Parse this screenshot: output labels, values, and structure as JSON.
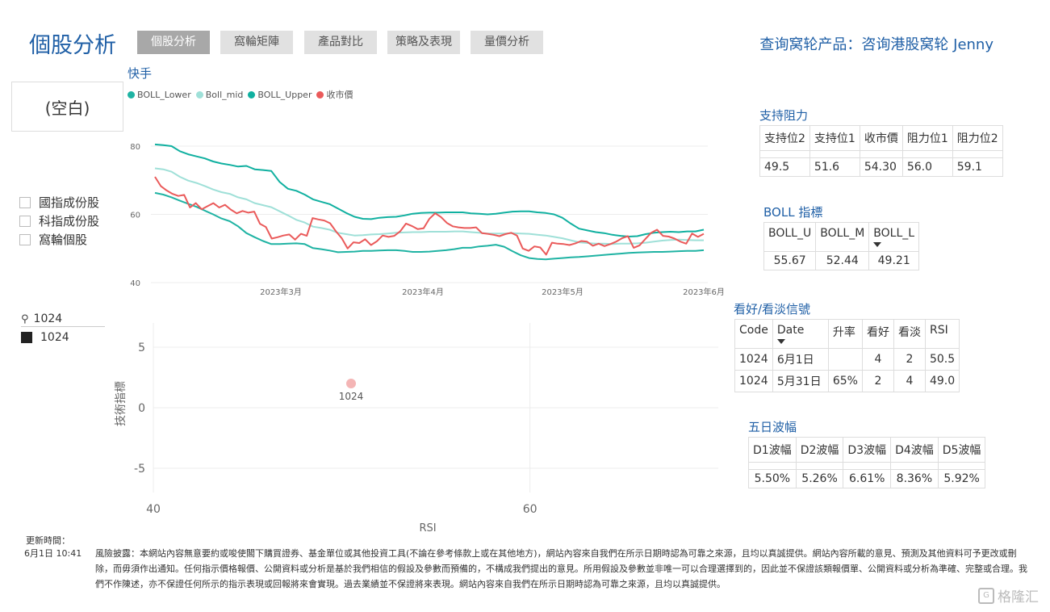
{
  "header": {
    "title": "個股分析",
    "tabs": [
      {
        "label": "個股分析",
        "active": true
      },
      {
        "label": "窩輪矩陣",
        "active": false
      },
      {
        "label": "產品對比",
        "active": false
      },
      {
        "label": "策略及表現",
        "active": false
      },
      {
        "label": "量價分析",
        "active": false
      }
    ],
    "contact": "查询窝轮产品：咨询港股窝轮 Jenny"
  },
  "slicer": {
    "value": "(空白)"
  },
  "filters": [
    "國指成份股",
    "科指成份股",
    "窩輪個股"
  ],
  "search": {
    "value": "1024",
    "selected_item": "1024"
  },
  "stock_chart": {
    "title": "快手",
    "legend": [
      {
        "name": "BOLL_Lower",
        "color": "#1fb3a3"
      },
      {
        "name": "Boll_mid",
        "color": "#9fe0d8"
      },
      {
        "name": "BOLL_Upper",
        "color": "#10b0a0"
      },
      {
        "name": "收市價",
        "color": "#ea5a5a"
      }
    ]
  },
  "colors": {
    "accent": "#1f5fa6",
    "upper": "#10b0a0",
    "lower": "#1fb3a3",
    "mid": "#9fe0d8",
    "close": "#ea5a5a",
    "scatter": "#f2a8a8"
  },
  "chart_data": [
    {
      "type": "line",
      "ylim": [
        40,
        80
      ],
      "yticks": [
        "80",
        "60",
        "40"
      ],
      "xticks": [
        "2023年3月",
        "2023年4月",
        "2023年5月",
        "2023年6月"
      ],
      "series": [
        {
          "name": "BOLL_Upper",
          "values": [
            80.5,
            80.3,
            80.0,
            78.5,
            77.6,
            77.0,
            76.4,
            75.5,
            74.9,
            74.5,
            74.0,
            74.2,
            73.2,
            73.0,
            72.7,
            69.5,
            67.5,
            66.9,
            65.8,
            64.4,
            63.7,
            63.0,
            61.7,
            60.4,
            59.3,
            58.7,
            58.6,
            59.0,
            59.2,
            59.3,
            59.7,
            60.2,
            60.4,
            60.5,
            60.5,
            60.6,
            60.6,
            60.6,
            60.3,
            60.2,
            60.0,
            60.2,
            60.5,
            60.8,
            60.9,
            60.9,
            60.6,
            60.4,
            60.0,
            59.0,
            57.3,
            55.8,
            55.3,
            54.8,
            54.5,
            54.0,
            53.7,
            53.5,
            53.6,
            54.2,
            54.6,
            54.8,
            54.9,
            54.8,
            55.0,
            55.0,
            55.5
          ]
        },
        {
          "name": "Boll_mid",
          "values": [
            73.5,
            73.2,
            72.5,
            71.0,
            69.9,
            69.2,
            68.3,
            67.3,
            66.5,
            66.0,
            65.0,
            64.4,
            63.3,
            62.7,
            62.1,
            60.9,
            59.7,
            58.4,
            57.6,
            56.4,
            56.0,
            55.5,
            54.6,
            54.2,
            53.8,
            53.9,
            54.1,
            54.2,
            54.4,
            54.6,
            54.7,
            54.8,
            54.8,
            54.9,
            54.9,
            54.9,
            55.0,
            55.0,
            54.8,
            54.6,
            54.4,
            54.4,
            54.4,
            54.5,
            54.4,
            54.3,
            54.0,
            53.8,
            53.4,
            53.0,
            52.4,
            51.8,
            51.6,
            51.4,
            51.4,
            51.3,
            51.4,
            51.4,
            51.5,
            51.7,
            52.0,
            52.3,
            52.5,
            52.6,
            52.5,
            52.4,
            52.4
          ]
        },
        {
          "name": "BOLL_Lower",
          "values": [
            66.3,
            65.8,
            65.0,
            64.0,
            63.1,
            62.2,
            61.1,
            60.0,
            58.8,
            58.0,
            56.5,
            54.5,
            53.3,
            52.2,
            51.3,
            51.3,
            51.4,
            51.5,
            51.3,
            50.1,
            49.8,
            49.4,
            48.9,
            49.0,
            49.1,
            49.3,
            49.3,
            49.4,
            49.5,
            49.5,
            49.3,
            49.0,
            49.0,
            49.1,
            49.3,
            49.5,
            49.8,
            50.2,
            50.2,
            50.6,
            50.8,
            51.1,
            50.5,
            49.2,
            48.0,
            47.2,
            46.9,
            46.8,
            47.0,
            47.2,
            47.4,
            47.5,
            47.7,
            47.9,
            48.1,
            48.3,
            48.5,
            48.7,
            48.8,
            48.9,
            49.0,
            49.0,
            49.1,
            49.2,
            49.3,
            49.3,
            49.5
          ]
        },
        {
          "name": "收市價",
          "values": [
            71.0,
            68.3,
            67.0,
            66.0,
            65.4,
            65.7,
            62.0,
            63.3,
            61.5,
            62.4,
            63.3,
            62.0,
            62.8,
            61.4,
            60.3,
            61.0,
            60.5,
            60.8,
            57.2,
            56.3,
            52.9,
            53.3,
            53.8,
            54.1,
            52.6,
            54.3,
            53.7,
            58.9,
            58.5,
            58.2,
            57.4,
            55.0,
            53.0,
            50.0,
            51.8,
            51.6,
            52.7,
            51.0,
            52.1,
            53.8,
            53.4,
            53.7,
            55.0,
            57.3,
            56.6,
            55.7,
            55.9,
            58.7,
            60.3,
            59.2,
            57.5,
            56.5,
            56.2,
            56.0,
            56.0,
            56.2,
            54.5,
            54.3,
            54.0,
            53.6,
            54.2,
            54.6,
            53.8,
            50.0,
            49.3,
            50.6,
            50.3,
            48.2,
            51.7,
            51.4,
            51.3,
            51.0,
            51.5,
            52.2,
            52.0,
            50.8,
            51.4,
            50.7,
            51.3,
            52.0,
            53.0,
            53.6,
            50.2,
            50.9,
            52.8,
            54.6,
            55.5,
            53.7,
            53.5,
            52.9,
            52.0,
            51.4,
            54.4,
            53.4,
            54.3
          ]
        }
      ]
    },
    {
      "type": "scatter",
      "xlabel": "RSI",
      "ylabel": "技術指標",
      "xlim": [
        40,
        70
      ],
      "ylim": [
        -7,
        7
      ],
      "xticks": [
        "40",
        "60"
      ],
      "yticks": [
        "5",
        "0",
        "-5"
      ],
      "points": [
        {
          "label": "1024",
          "x": 50.5,
          "y": 2
        }
      ]
    }
  ],
  "support_resistance": {
    "title": "支持阻力",
    "headers": [
      "支持位2",
      "支持位1",
      "收市價",
      "阻力位1",
      "阻力位2"
    ],
    "values": [
      "49.5",
      "51.6",
      "54.30",
      "56.0",
      "59.1"
    ]
  },
  "boll": {
    "title": "BOLL 指標",
    "headers": [
      "BOLL_U",
      "BOLL_M",
      "BOLL_L"
    ],
    "values": [
      "55.67",
      "52.44",
      "49.21"
    ]
  },
  "signals": {
    "title": "看好/看淡信號",
    "headers": [
      "Code",
      "Date",
      "升率",
      "看好",
      "看淡",
      "RSI"
    ],
    "rows": [
      [
        "1024",
        "6月1日",
        "",
        "4",
        "2",
        "50.5"
      ],
      [
        "1024",
        "5月31日",
        "65%",
        "2",
        "4",
        "49.0"
      ]
    ]
  },
  "five_day": {
    "title": "五日波幅",
    "headers": [
      "D1波幅",
      "D2波幅",
      "D3波幅",
      "D4波幅",
      "D5波幅"
    ],
    "values": [
      "5.50%",
      "5.26%",
      "6.61%",
      "8.36%",
      "5.92%"
    ]
  },
  "footer": {
    "update_label": "更新時間：",
    "update_time": "6月1日 10:41",
    "disclaimer": "風險披露：本網站內容無意要約或唆使閣下購買證券、基金單位或其他投資工具(不論在參考條款上或在其他地方)，網站內容來自我們在所示日期時認為可靠之來源，且均以真誠提供。網站內容所載的意見、預測及其他資料可予更改或刪除，而毋須作出通知。任何指示價格報價、公開資料或分析是基於我們相信的假設及參數而預備的，不構成我們提出的意見。所用假設及參數並非唯一可以合理選擇到的，因此並不保證該類報價單、公開資料或分析為準確、完整或合理。我們不作陳述，亦不保證任何所示的指示表現或回報將來會實現。過去業績並不保證將來表現。網站內容來自我們在所示日期時認為可靠之來源，且均以真誠提供。",
    "watermark": "格隆汇"
  }
}
